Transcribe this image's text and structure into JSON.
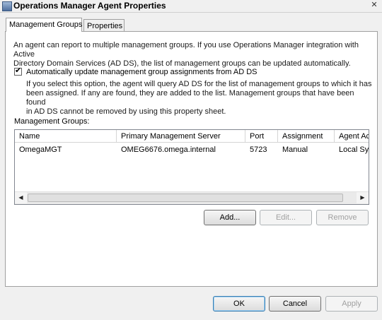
{
  "window": {
    "title": "Operations Manager Agent Properties",
    "close_glyph": "✕"
  },
  "tabs": [
    {
      "label": "Management Groups",
      "active": true
    },
    {
      "label": "Properties",
      "active": false
    }
  ],
  "intro": {
    "line1": "An agent can report to multiple management groups. If you use Operations Manager integration with Active",
    "line2": "Directory Domain Services (AD DS), the list of management groups can be updated automatically."
  },
  "auto_update": {
    "checked": true,
    "label": "Automatically update management group assignments from AD DS",
    "line1": "If you select this option, the agent will query AD DS for the list of management groups to which it has",
    "line2": "been assigned. If any are found, they are added to the list. Management groups that have been found",
    "line3": "in AD DS cannot be removed by using this property sheet."
  },
  "groups": {
    "label": "Management Groups:",
    "columns": [
      "Name",
      "Primary Management Server",
      "Port",
      "Assignment",
      "Agent Ac"
    ],
    "rows": [
      [
        "OmegaMGT",
        "OMEG6676.omega.internal",
        "5723",
        "Manual",
        "Local Sy"
      ]
    ]
  },
  "list_buttons": {
    "add": {
      "label": "Add...",
      "enabled": true
    },
    "edit": {
      "label": "Edit...",
      "enabled": false
    },
    "remove": {
      "label": "Remove",
      "enabled": false
    }
  },
  "dialog_buttons": {
    "ok": "OK",
    "cancel": "Cancel",
    "apply": "Apply"
  }
}
